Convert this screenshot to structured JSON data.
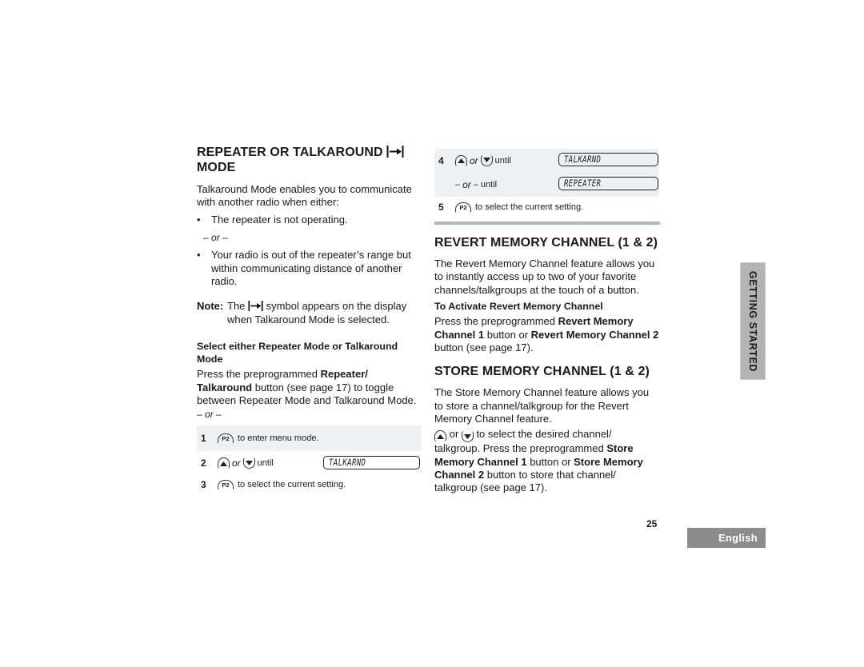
{
  "left": {
    "heading_line1": "REPEATER OR TALKAROUND",
    "heading_icon": "talkaround-icon",
    "heading_line2": "MODE",
    "intro": "Talkaround Mode enables you to communicate with another radio when either:",
    "bullet1": "The repeater is not operating.",
    "or_text": "or",
    "bullet2": "Your radio is out of the repeater’s range but within communicating distance of another radio.",
    "note_label": "Note:",
    "note_pre": "The",
    "note_post": "symbol appears on the display when Talkaround Mode is selected.",
    "subheading": "Select either Repeater Mode or Talkaround Mode",
    "press_pre": "Press the preprogrammed ",
    "press_bold": "Repeater/ Talkaround",
    "press_post": " button (see page 17) to toggle between Repeater Mode and Talkaround Mode.",
    "or_text2": "or",
    "steps": [
      {
        "num": "1",
        "button": "P2",
        "text": "to enter menu mode."
      },
      {
        "num": "2",
        "or": "or",
        "until": "until",
        "lcd": "TALKARND"
      },
      {
        "num": "3",
        "button": "P2",
        "text": "to select the current setting."
      }
    ]
  },
  "right": {
    "steps": [
      {
        "num": "4",
        "or": "or",
        "until": "until",
        "lcd": "TALKARND"
      },
      {
        "or": "or",
        "until": "until",
        "lcd": "REPEATER"
      },
      {
        "num": "5",
        "button": "P2",
        "text": "to select the current setting."
      }
    ],
    "revert_heading": "REVERT MEMORY CHANNEL (1 & 2)",
    "revert_intro": "The Revert Memory Channel feature allows you to instantly access up to two of your favorite channels/talkgroups at the touch of a button.",
    "revert_sub": "To Activate Revert Memory Channel",
    "revert_p_pre": "Press the preprogrammed ",
    "revert_p_b1": "Revert Memory Channel 1",
    "revert_p_mid": " button or ",
    "revert_p_b2": "Revert Memory Channel 2",
    "revert_p_post": " button (see page 17).",
    "store_heading": "STORE MEMORY CHANNEL (1 & 2)",
    "store_intro": "The Store Memory Channel feature allows you to store a channel/talkgroup for the Revert Memory Channel feature.",
    "store_or": "or",
    "store_p_pre": "to select the desired channel/ talkgroup. Press the preprogrammed ",
    "store_p_b1": "Store Memory Channel 1",
    "store_p_mid": " button or ",
    "store_p_b2": "Store Memory Channel 2",
    "store_p_post": " button to store that channel/ talkgroup (see page 17)."
  },
  "side_tab": "GETTING STARTED",
  "page_number": "25",
  "language_tab": "English",
  "colors": {
    "step_shade": "#eef1f4",
    "separator": "#a6bcc6",
    "side_tab": "#b3b3b3",
    "language_tab": "#8c8c8c"
  }
}
